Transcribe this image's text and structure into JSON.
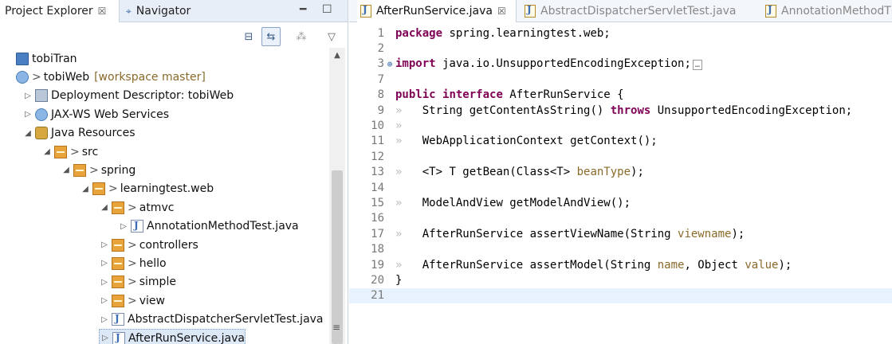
{
  "left_tabs": [
    {
      "label": "Project Explorer",
      "close": "☒",
      "icon": "project-explorer-icon"
    },
    {
      "label": "Navigator",
      "icon": "navigator-icon"
    }
  ],
  "window_buttons": {
    "minimize": "━",
    "maximize": "☐"
  },
  "toolbar": {
    "collapse": "⊟",
    "link": "⇆",
    "menu": "▽",
    "focus": "⁂"
  },
  "tree": [
    {
      "label": "tobiTran",
      "indent": 0,
      "twisty": "",
      "icon": "project-icon",
      "icls": "ico-proj",
      "dirty": false
    },
    {
      "label": "tobiWeb",
      "suffix": "[workspace master]",
      "indent": 0,
      "twisty": "",
      "icon": "web-project-icon",
      "icls": "ico-web",
      "dirty": true
    },
    {
      "label": "Deployment Descriptor: tobiWeb",
      "indent": 1,
      "twisty": "▷",
      "icon": "descriptor-icon",
      "icls": "ico-desc",
      "dirty": false
    },
    {
      "label": "JAX-WS Web Services",
      "indent": 1,
      "twisty": "▷",
      "icon": "webservices-icon",
      "icls": "ico-web",
      "dirty": false
    },
    {
      "label": "Java Resources",
      "indent": 1,
      "twisty": "◢",
      "icon": "java-resources-icon",
      "icls": "ico-jar",
      "dirty": false
    },
    {
      "label": "src",
      "indent": 2,
      "twisty": "◢",
      "icon": "source-folder-icon",
      "icls": "ico-pkg",
      "dirty": true
    },
    {
      "label": "spring",
      "indent": 3,
      "twisty": "◢",
      "icon": "package-icon",
      "icls": "ico-pkg",
      "dirty": true
    },
    {
      "label": "learningtest.web",
      "indent": 4,
      "twisty": "◢",
      "icon": "package-icon",
      "icls": "ico-pkg",
      "dirty": true
    },
    {
      "label": "atmvc",
      "indent": 5,
      "twisty": "◢",
      "icon": "package-icon",
      "icls": "ico-pkg",
      "dirty": true
    },
    {
      "label": "AnnotationMethodTest.java",
      "indent": 6,
      "twisty": "▷",
      "icon": "java-file-icon",
      "icls": "ico-java",
      "dirty": false
    },
    {
      "label": "controllers",
      "indent": 5,
      "twisty": "▷",
      "icon": "package-icon",
      "icls": "ico-pkg",
      "dirty": true
    },
    {
      "label": "hello",
      "indent": 5,
      "twisty": "▷",
      "icon": "package-icon",
      "icls": "ico-pkg",
      "dirty": true
    },
    {
      "label": "simple",
      "indent": 5,
      "twisty": "▷",
      "icon": "package-icon",
      "icls": "ico-pkg",
      "dirty": true
    },
    {
      "label": "view",
      "indent": 5,
      "twisty": "▷",
      "icon": "package-icon",
      "icls": "ico-pkg",
      "dirty": true
    },
    {
      "label": "AbstractDispatcherServletTest.java",
      "indent": 5,
      "twisty": "▷",
      "icon": "java-file-icon",
      "icls": "ico-java",
      "dirty": false
    },
    {
      "label": "AfterRunService.java",
      "indent": 5,
      "twisty": "▷",
      "icon": "java-file-icon",
      "icls": "ico-java",
      "dirty": false,
      "selected": true
    }
  ],
  "editor_tabs": [
    {
      "label": "AfterRunService.java",
      "close": "☒",
      "active": true
    },
    {
      "label": "AbstractDispatcherServletTest.java",
      "active": false
    },
    {
      "label": "AnnotationMethodT",
      "active": false
    }
  ],
  "code_lines": [
    {
      "num": "1",
      "html": "<span class=\"kw\">package</span> spring.learningtest.web;"
    },
    {
      "num": "2",
      "html": ""
    },
    {
      "num": "3",
      "fold": "⊕",
      "html": "<span class=\"kw\">import</span> java.io.UnsupportedEncodingException;<span class=\"collapsed\">…</span>"
    },
    {
      "num": "7",
      "html": ""
    },
    {
      "num": "8",
      "html": "<span class=\"kw\">public</span> <span class=\"kw\">interface</span> AfterRunService {"
    },
    {
      "num": "9",
      "html": "<span class=\"tabmark\">»</span>   String getContentAsString() <span class=\"kw\">throws</span> UnsupportedEncodingException;"
    },
    {
      "num": "10",
      "html": "<span class=\"tabmark\">»</span>"
    },
    {
      "num": "11",
      "html": "<span class=\"tabmark\">»</span>   WebApplicationContext getContext();"
    },
    {
      "num": "12",
      "html": ""
    },
    {
      "num": "13",
      "html": "<span class=\"tabmark\">»</span>   &lt;T&gt; T getBean(Class&lt;T&gt; <span class=\"param\">beanType</span>);"
    },
    {
      "num": "14",
      "html": ""
    },
    {
      "num": "15",
      "html": "<span class=\"tabmark\">»</span>   ModelAndView getModelAndView();"
    },
    {
      "num": "16",
      "html": ""
    },
    {
      "num": "17",
      "html": "<span class=\"tabmark\">»</span>   AfterRunService assertViewName(String <span class=\"param\">viewname</span>);"
    },
    {
      "num": "18",
      "html": ""
    },
    {
      "num": "19",
      "html": "<span class=\"tabmark\">»</span>   AfterRunService assertModel(String <span class=\"param\">name</span>, Object <span class=\"param\">value</span>);"
    },
    {
      "num": "20",
      "html": "}"
    },
    {
      "num": "21",
      "html": "",
      "current": true
    }
  ],
  "colors": {
    "keyword": "#7f0055",
    "tab_bar": "#e8eef7",
    "selection": "#dde8f6",
    "current_line": "#e8f2fe"
  }
}
